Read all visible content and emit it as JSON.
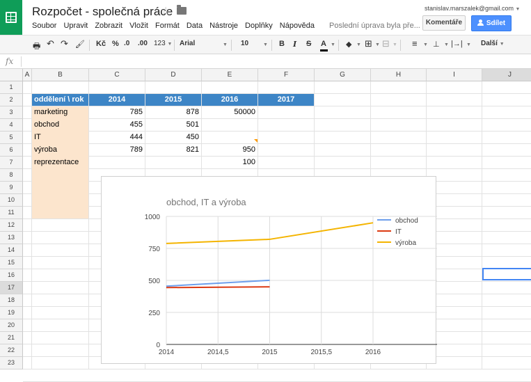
{
  "header": {
    "title": "Rozpočet - společná práce",
    "menu": [
      "Soubor",
      "Upravit",
      "Zobrazit",
      "Vložit",
      "Formát",
      "Data",
      "Nástroje",
      "Doplňky",
      "Nápověda"
    ],
    "last_edit": "Poslední úprava byla pře...",
    "account_email": "stanislav.marszalek@gmail.com",
    "comments_label": "Komentáře",
    "share_label": "Sdílet",
    "logo_icon": "sheets-logo-icon",
    "brand_color": "#0f9d58",
    "share_color": "#4d90fe"
  },
  "toolbar": {
    "print": "🖶",
    "undo": "↶",
    "redo": "↷",
    "paint": "🖌",
    "currency": "Kč",
    "percent": "%",
    "dec_less": ".0",
    "dec_more": ".00",
    "more_formats": "123",
    "font": "Arial",
    "font_size": "10",
    "bold": "B",
    "italic": "I",
    "strike": "S",
    "text_color": "A",
    "fill": "◆",
    "borders": "⊞",
    "merge": "⊟",
    "halign": "≡",
    "valign": "⊥",
    "wrap": "|→|",
    "more": "Další"
  },
  "formula_bar": {
    "fx": "fx",
    "value": ""
  },
  "columns": [
    "A",
    "B",
    "C",
    "D",
    "E",
    "F",
    "G",
    "H",
    "I",
    "J"
  ],
  "selected_column": "J",
  "rows": [
    "1",
    "2",
    "3",
    "4",
    "5",
    "6",
    "7",
    "8",
    "9",
    "10",
    "11",
    "12",
    "13",
    "14",
    "15",
    "16",
    "17",
    "18",
    "19",
    "20",
    "21",
    "22",
    "23"
  ],
  "selected_row": "17",
  "table": {
    "header": [
      "oddělení \\ rok",
      "2014",
      "2015",
      "2016",
      "2017"
    ],
    "rows": [
      [
        "marketing",
        "785",
        "878",
        "50000",
        ""
      ],
      [
        "obchod",
        "455",
        "501",
        "",
        ""
      ],
      [
        "IT",
        "444",
        "450",
        "",
        ""
      ],
      [
        "výroba",
        "789",
        "821",
        "950",
        ""
      ],
      [
        "reprezentace",
        "",
        "",
        "100",
        ""
      ]
    ],
    "header_color": "#3d85c6",
    "label_fill": "#fce5cd"
  },
  "chart_data": {
    "type": "line",
    "title": "obchod, IT a výroba",
    "x": [
      2014,
      2015,
      2016
    ],
    "xticks": [
      "2014",
      "2014,5",
      "2015",
      "2015,5",
      "2016"
    ],
    "yticks": [
      "0",
      "250",
      "500",
      "750",
      "1000"
    ],
    "xlim": [
      2014,
      2016
    ],
    "ylim": [
      0,
      1000
    ],
    "grid": true,
    "legend": "right",
    "series": [
      {
        "name": "obchod",
        "color": "#6d9eeb",
        "values": [
          455,
          501,
          null
        ]
      },
      {
        "name": "IT",
        "color": "#dc3912",
        "values": [
          444,
          450,
          null
        ]
      },
      {
        "name": "výroba",
        "color": "#f4b400",
        "values": [
          789,
          821,
          950
        ]
      }
    ]
  }
}
